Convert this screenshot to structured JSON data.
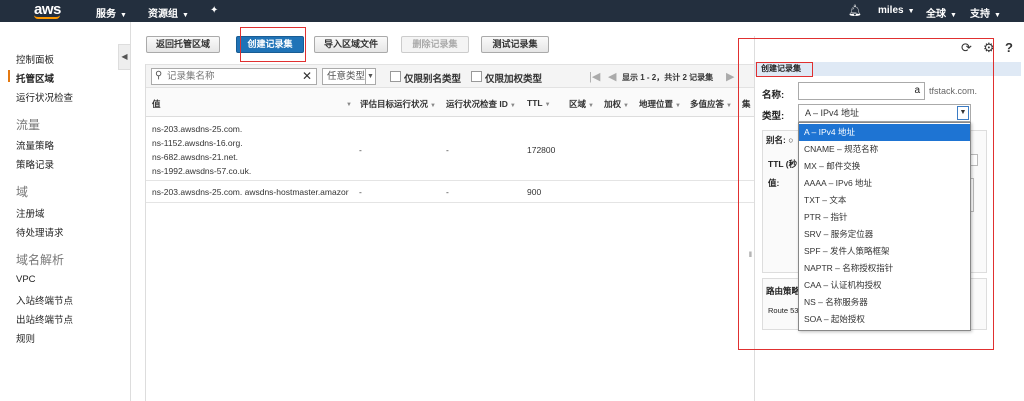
{
  "topnav": {
    "logo": "aws",
    "services": "服务",
    "resource_groups": "资源组",
    "user": "miles",
    "region": "全球",
    "support": "支持"
  },
  "sidebar": {
    "items_top": [
      "控制面板",
      "托管区域",
      "运行状况检查"
    ],
    "section_traffic": "流量",
    "items_traffic": [
      "流量策略",
      "策略记录"
    ],
    "section_domain": "域",
    "items_domain": [
      "注册域",
      "待处理请求"
    ],
    "section_resolver": "域名解析",
    "items_resolver": [
      "VPC",
      "入站终端节点",
      "出站终端节点",
      "规则"
    ]
  },
  "toolbar": {
    "back": "返回托管区域",
    "create": "创建记录集",
    "import": "导入区域文件",
    "delete": "删除记录集",
    "test": "测试记录集"
  },
  "filter": {
    "search_placeholder": "记录集名称",
    "type_select": "任意类型",
    "alias_only": "仅限别名类型",
    "weighted_only": "仅限加权类型",
    "pager_text": "显示 1 - 2，共计 2 记录集"
  },
  "table": {
    "headers": [
      "值",
      "评估目标运行状况",
      "运行状况检查 ID",
      "TTL",
      "区域",
      "加权",
      "地理位置",
      "多值应答",
      "集"
    ],
    "rows": [
      {
        "values": [
          "ns-203.awsdns-25.com.",
          "ns-1152.awsdns-16.org.",
          "ns-682.awsdns-21.net.",
          "ns-1992.awsdns-57.co.uk."
        ],
        "eval": "-",
        "hc": "-",
        "ttl": "172800"
      },
      {
        "values": [
          "ns-203.awsdns-25.com. awsdns-hostmaster.amazor"
        ],
        "eval": "-",
        "hc": "-",
        "ttl": "900"
      }
    ]
  },
  "panel": {
    "title": "创建记录集",
    "name_label": "名称:",
    "name_value": "a",
    "name_suffix": "tfstack.com.",
    "type_label": "类型:",
    "type_value": "A – IPv4 地址",
    "alias_label": "别名:",
    "ttl_label": "TTL (秒",
    "value_label": "值:",
    "routing_label": "路由策略",
    "routing_value": "Route 53",
    "type_options": [
      "A – IPv4 地址",
      "CNAME – 规范名称",
      "MX – 邮件交换",
      "AAAA – IPv6 地址",
      "TXT – 文本",
      "PTR – 指针",
      "SRV – 服务定位器",
      "SPF – 发件人策略框架",
      "NAPTR – 名称授权指针",
      "CAA – 认证机构授权",
      "NS – 名称服务器",
      "SOA – 起始授权"
    ],
    "selected_option": "A – IPv4 地址"
  },
  "colors": {
    "nav_bg": "#232f3e",
    "primary": "#1f73b7",
    "highlight": "#1e74d3",
    "annotation_red": "#e03030",
    "accent_orange": "#e47911"
  }
}
